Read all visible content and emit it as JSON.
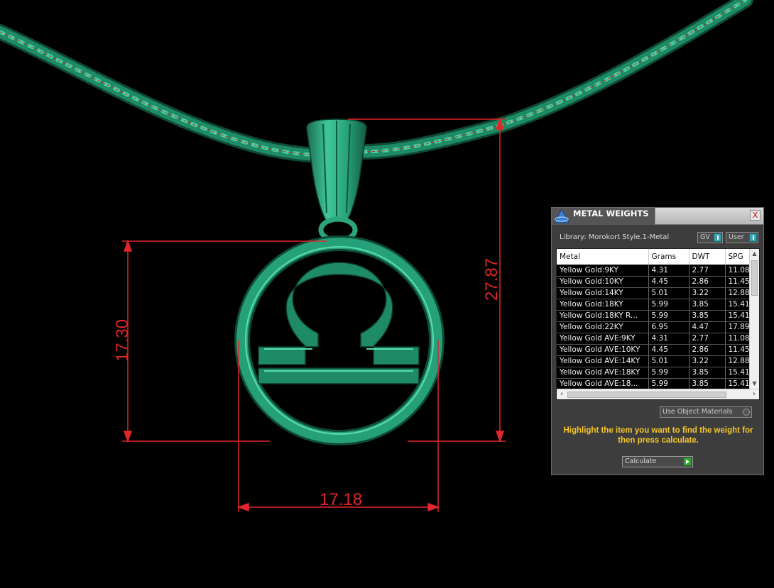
{
  "viewport": {
    "dimensions": {
      "height": "27.87",
      "left_height": "17.30",
      "width": "17.18"
    },
    "colors": {
      "model": "#1f8a66",
      "model_highlight": "#3fc79a",
      "dimension": "#e0262a"
    }
  },
  "panel": {
    "title": "METAL WEIGHTS",
    "close_label": "X",
    "library_label": "Library: Morokort Style.1-Metal",
    "toggles": {
      "gv": "GV",
      "user": "User"
    },
    "table": {
      "headers": [
        "Metal",
        "Grams",
        "DWT",
        "SPG"
      ],
      "rows": [
        [
          "Yellow Gold:9KY",
          "4.31",
          "2.77",
          "11.08"
        ],
        [
          "Yellow Gold:10KY",
          "4.45",
          "2.86",
          "11.45"
        ],
        [
          "Yellow Gold:14KY",
          "5.01",
          "3.22",
          "12.88"
        ],
        [
          "Yellow Gold:18KY",
          "5.99",
          "3.85",
          "15.41"
        ],
        [
          "Yellow Gold:18KY R...",
          "5.99",
          "3.85",
          "15.41"
        ],
        [
          "Yellow Gold:22KY",
          "6.95",
          "4.47",
          "17.89"
        ],
        [
          "Yellow Gold AVE:9KY",
          "4.31",
          "2.77",
          "11.08"
        ],
        [
          "Yellow Gold AVE:10KY",
          "4.45",
          "2.86",
          "11.45"
        ],
        [
          "Yellow Gold AVE:14KY",
          "5.01",
          "3.22",
          "12.88"
        ],
        [
          "Yellow Gold AVE:18KY",
          "5.99",
          "3.85",
          "15.41"
        ],
        [
          "Yellow Gold AVE:18...",
          "5.99",
          "3.85",
          "15.41"
        ]
      ]
    },
    "use_object_materials": "Use Object Materials",
    "hint": "Highlight the item you want to find the weight for then press calculate.",
    "calculate_label": "Calculate",
    "colors": {
      "hint": "#f7c72a",
      "accent": "#3aa5b5",
      "play": "#35a535"
    }
  }
}
